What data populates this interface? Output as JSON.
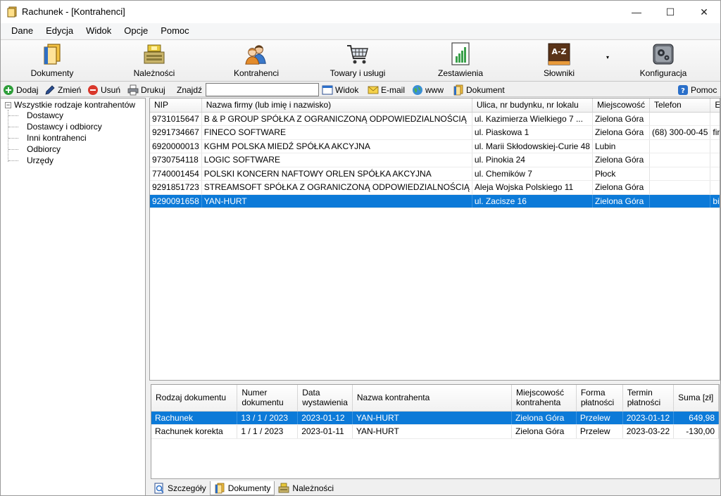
{
  "window": {
    "title": "Rachunek - [Kontrahenci]",
    "min_glyph": "—",
    "max_glyph": "☐",
    "close_glyph": "✕"
  },
  "menu": {
    "items": [
      "Dane",
      "Edycja",
      "Widok",
      "Opcje",
      "Pomoc"
    ]
  },
  "big_toolbar": {
    "items": [
      {
        "label": "Dokumenty",
        "icon": "documents-icon"
      },
      {
        "label": "Należności",
        "icon": "receivables-icon"
      },
      {
        "label": "Kontrahenci",
        "icon": "contractors-icon"
      },
      {
        "label": "Towary i usługi",
        "icon": "cart-icon"
      },
      {
        "label": "Zestawienia",
        "icon": "report-icon"
      },
      {
        "label": "Słowniki",
        "icon": "dictionary-icon",
        "icon_text": "A-Z"
      },
      {
        "label": "Konfiguracja",
        "icon": "settings-icon"
      }
    ],
    "dropdown_glyph": "▾"
  },
  "small_toolbar": {
    "add": "Dodaj",
    "edit": "Zmień",
    "delete": "Usuń",
    "print": "Drukuj",
    "find_label": "Znajdź",
    "find_value": "",
    "view": "Widok",
    "email": "E-mail",
    "www": "www",
    "document": "Dokument",
    "help": "Pomoc"
  },
  "tree": {
    "root": "Wszystkie rodzaje kontrahentów",
    "expander": "−",
    "children": [
      "Dostawcy",
      "Dostawcy i odbiorcy",
      "Inni kontrahenci",
      "Odbiorcy",
      "Urzędy"
    ]
  },
  "contractors": {
    "columns": [
      "NIP",
      "Nazwa firmy (lub imię i nazwisko)",
      "Ulica, nr budynku, nr lokalu",
      "Miejscowość",
      "Telefon",
      "E-mail"
    ],
    "rows": [
      [
        "9731015647",
        "B & P GROUP SPÓŁKA Z OGRANICZONĄ ODPOWIEDZIALNOŚCIĄ",
        "ul. Kazimierza Wielkiego 7 ...",
        "Zielona Góra",
        "",
        ""
      ],
      [
        "9291734667",
        "FINECO SOFTWARE",
        "ul. Piaskowa 1",
        "Zielona Góra",
        "(68) 300-00-45",
        "fineco@fineco.pl"
      ],
      [
        "6920000013",
        "KGHM POLSKA MIEDŹ SPÓŁKA AKCYJNA",
        "ul. Marii Skłodowskiej-Curie 48",
        "Lubin",
        "",
        ""
      ],
      [
        "9730754118",
        "LOGIC SOFTWARE",
        "ul. Pinokia 24",
        "Zielona Góra",
        "",
        ""
      ],
      [
        "7740001454",
        "POLSKI KONCERN NAFTOWY ORLEN SPÓŁKA AKCYJNA",
        "ul. Chemików 7",
        "Płock",
        "",
        ""
      ],
      [
        "9291851723",
        "STREAMSOFT SPÓŁKA Z OGRANICZONĄ ODPOWIEDZIALNOŚCIĄ",
        "Aleja Wojska Polskiego 11",
        "Zielona Góra",
        "",
        ""
      ],
      [
        "9290091658",
        "YAN-HURT",
        "ul. Zacisze 16",
        "Zielona Góra",
        "",
        "biuro@yan-hurt.pl"
      ]
    ],
    "selected_index": 6
  },
  "documents": {
    "columns": [
      "Rodzaj dokumentu",
      "Numer dokumentu",
      "Data wystawienia",
      "Nazwa kontrahenta",
      "Miejscowość kontrahenta",
      "Forma płatności",
      "Termin płatności",
      "Suma [zł]"
    ],
    "rows": [
      [
        "Rachunek",
        "13 / 1 / 2023",
        "2023-01-12",
        "YAN-HURT",
        "Zielona Góra",
        "Przelew",
        "2023-01-12",
        "649,98"
      ],
      [
        "Rachunek korekta",
        "1 / 1 / 2023",
        "2023-01-11",
        "YAN-HURT",
        "Zielona Góra",
        "Przelew",
        "2023-03-22",
        "-130,00"
      ]
    ],
    "selected_index": 0
  },
  "bottom_tabs": [
    {
      "label": "Szczegóły",
      "active": false
    },
    {
      "label": "Dokumenty",
      "active": true
    },
    {
      "label": "Należności",
      "active": false
    }
  ],
  "colors": {
    "selection": "#0c7ad8",
    "add_green": "#2e9e3a",
    "delete_red": "#d9382c"
  }
}
